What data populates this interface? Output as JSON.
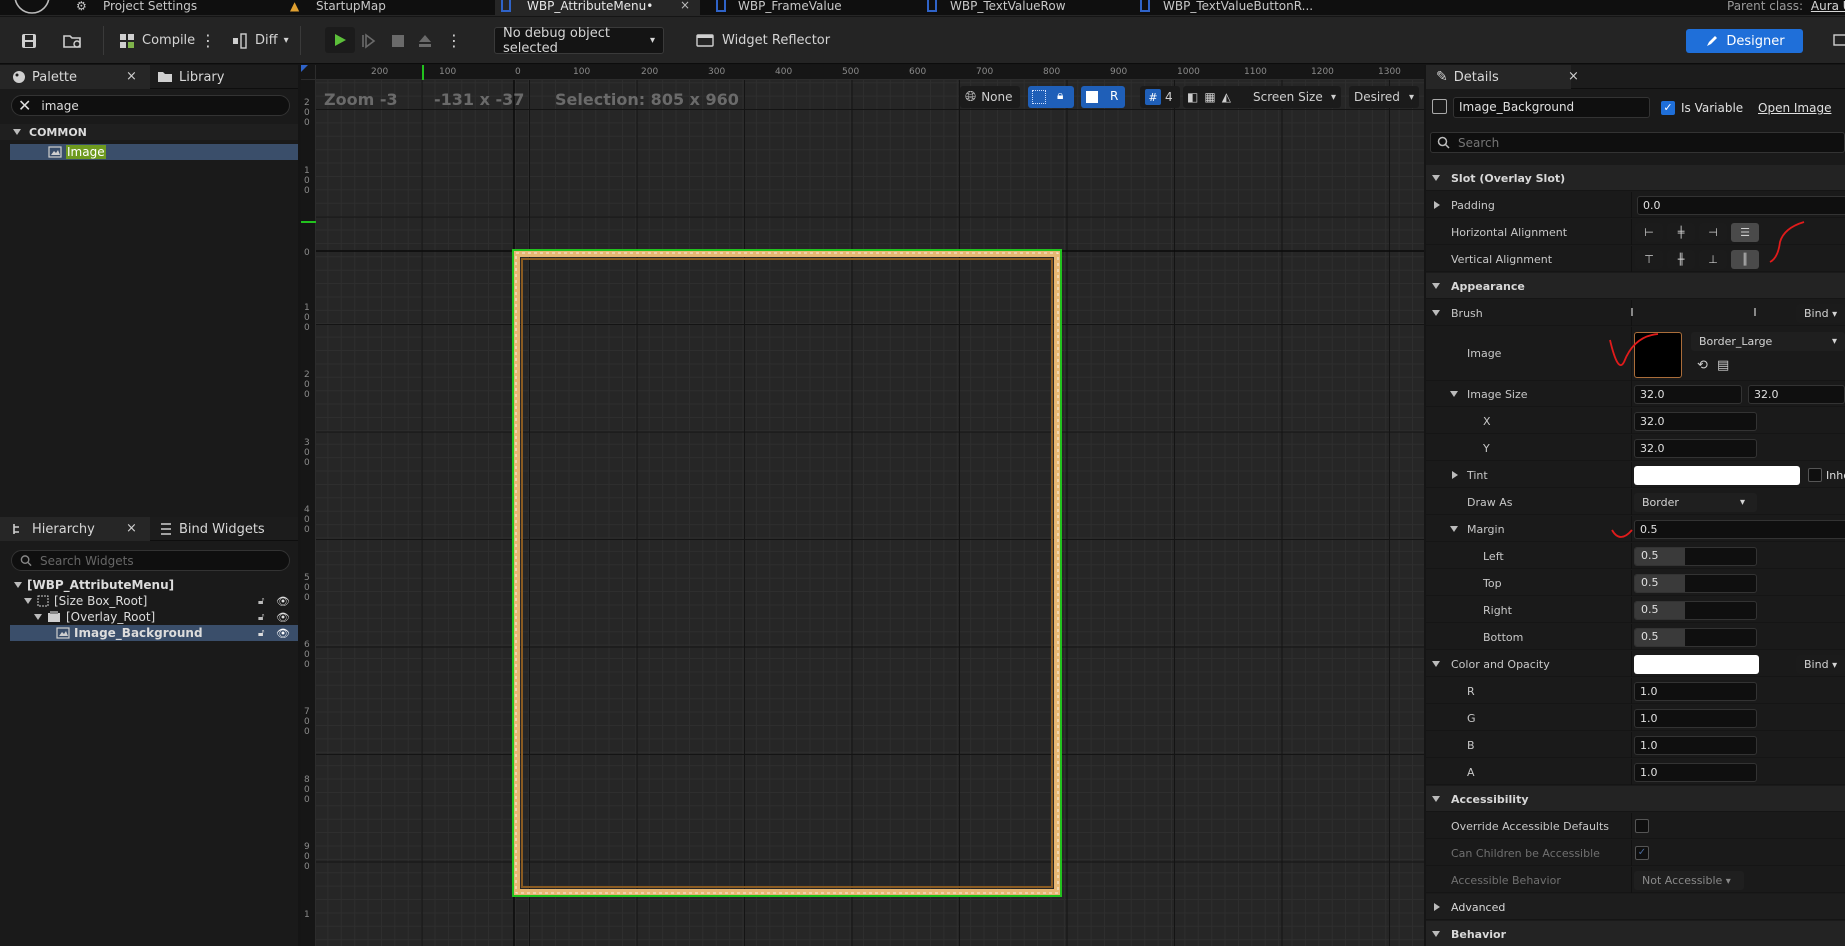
{
  "tabs": {
    "items": [
      {
        "label": "Project Settings"
      },
      {
        "label": "StartupMap"
      },
      {
        "label": "WBP_AttributeMenu•"
      },
      {
        "label": "WBP_FrameValue"
      },
      {
        "label": "WBP_TextValueRow"
      },
      {
        "label": "WBP_TextValueButtonR..."
      }
    ],
    "parent_class_label": "Parent class:",
    "parent_class_value": "Aura U",
    "close_glyph": "×"
  },
  "toolbar": {
    "compile_label": "Compile",
    "diff_label": "Diff",
    "debug_selector": "No debug object selected",
    "widget_reflector": "Widget Reflector",
    "designer_label": "Designer"
  },
  "palette": {
    "tab_label": "Palette",
    "library_label": "Library",
    "search_value": "image",
    "category": "COMMON",
    "items": [
      {
        "label": "Image"
      }
    ]
  },
  "hierarchy": {
    "tab_label": "Hierarchy",
    "bind_widgets_label": "Bind Widgets",
    "search_placeholder": "Search Widgets",
    "root": "[WBP_AttributeMenu]",
    "nodes": [
      {
        "label": "[Size Box_Root]"
      },
      {
        "label": "[Overlay_Root]"
      },
      {
        "label": "Image_Background"
      }
    ]
  },
  "viewport": {
    "zoom": "Zoom -3",
    "cursor": "-131 x -37",
    "selection": "Selection: 805 x 960",
    "localization": "None",
    "grid_snap": "4",
    "r_label": "R",
    "screen_size": "Screen Size",
    "desired": "Desired",
    "ruler_top": [
      "200",
      "100",
      "0",
      "100",
      "200",
      "300",
      "400",
      "500",
      "600",
      "700",
      "800",
      "900",
      "1000",
      "1100",
      "1200",
      "1300"
    ],
    "ruler_left": [
      "200",
      "100",
      "0",
      "100",
      "200",
      "300",
      "400",
      "500",
      "600",
      "700",
      "800",
      "900",
      "1"
    ]
  },
  "details": {
    "tab_label": "Details",
    "widget_name": "Image_Background",
    "is_variable_label": "Is Variable",
    "open_image_label": "Open Image",
    "search_placeholder": "Search",
    "slot_section": "Slot (Overlay Slot)",
    "padding_label": "Padding",
    "padding_value": "0.0",
    "h_align_label": "Horizontal Alignment",
    "v_align_label": "Vertical Alignment",
    "appearance_section": "Appearance",
    "brush_label": "Brush",
    "bind_label": "Bind",
    "image_label": "Image",
    "image_asset": "Border_Large",
    "image_size_label": "Image Size",
    "image_size_x": "32.0",
    "image_size_y": "32.0",
    "x_label": "X",
    "y_label": "Y",
    "tint_label": "Tint",
    "inherit_label": "Inhe",
    "draw_as_label": "Draw As",
    "draw_as_value": "Border",
    "margin_label": "Margin",
    "margin_value": "0.5",
    "left_label": "Left",
    "top_label": "Top",
    "right_label": "Right",
    "bottom_label": "Bottom",
    "margin_left": "0.5",
    "margin_top": "0.5",
    "margin_right": "0.5",
    "margin_bottom": "0.5",
    "color_opacity_label": "Color and Opacity",
    "r_label": "R",
    "g_label": "G",
    "b_label": "B",
    "a_label": "A",
    "r_value": "1.0",
    "g_value": "1.0",
    "b_value": "1.0",
    "a_value": "1.0",
    "accessibility_section": "Accessibility",
    "override_accessible_label": "Override Accessible Defaults",
    "children_accessible_label": "Can Children be Accessible",
    "accessible_behavior_label": "Accessible Behavior",
    "accessible_behavior_value": "Not Accessible",
    "advanced_section": "Advanced",
    "behavior_section": "Behavior"
  },
  "colors": {
    "accent_blue": "#1f6fd9",
    "selection_green": "#22c21e",
    "frame_gold": "#e7b773",
    "annotation_red": "#e01b1b"
  }
}
